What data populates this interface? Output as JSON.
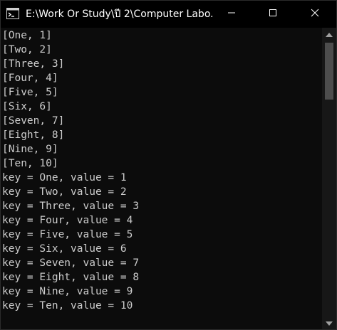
{
  "window": {
    "title": "E:\\Work Or Study\\ปี 2\\Computer Labo..."
  },
  "icons": {
    "app": "console-app-icon",
    "minimize": "minimize-icon",
    "maximize": "maximize-icon",
    "close": "close-icon",
    "scroll_up": "scroll-up-arrow-icon",
    "scroll_down": "scroll-down-arrow-icon"
  },
  "scroll": {
    "thumb_position_fraction": 0.0,
    "visible_fraction": 0.2
  },
  "console": {
    "lines": [
      "[One, 1]",
      "[Two, 2]",
      "[Three, 3]",
      "[Four, 4]",
      "[Five, 5]",
      "[Six, 6]",
      "[Seven, 7]",
      "[Eight, 8]",
      "[Nine, 9]",
      "[Ten, 10]",
      "key = One, value = 1",
      "key = Two, value = 2",
      "key = Three, value = 3",
      "key = Four, value = 4",
      "key = Five, value = 5",
      "key = Six, value = 6",
      "key = Seven, value = 7",
      "key = Eight, value = 8",
      "key = Nine, value = 9",
      "key = Ten, value = 10"
    ]
  },
  "colors": {
    "background": "#0c0c0c",
    "text": "#cccccc",
    "titlebar": "#000000",
    "scrollbar_track": "#171717",
    "scrollbar_thumb": "#4d4d4d"
  }
}
